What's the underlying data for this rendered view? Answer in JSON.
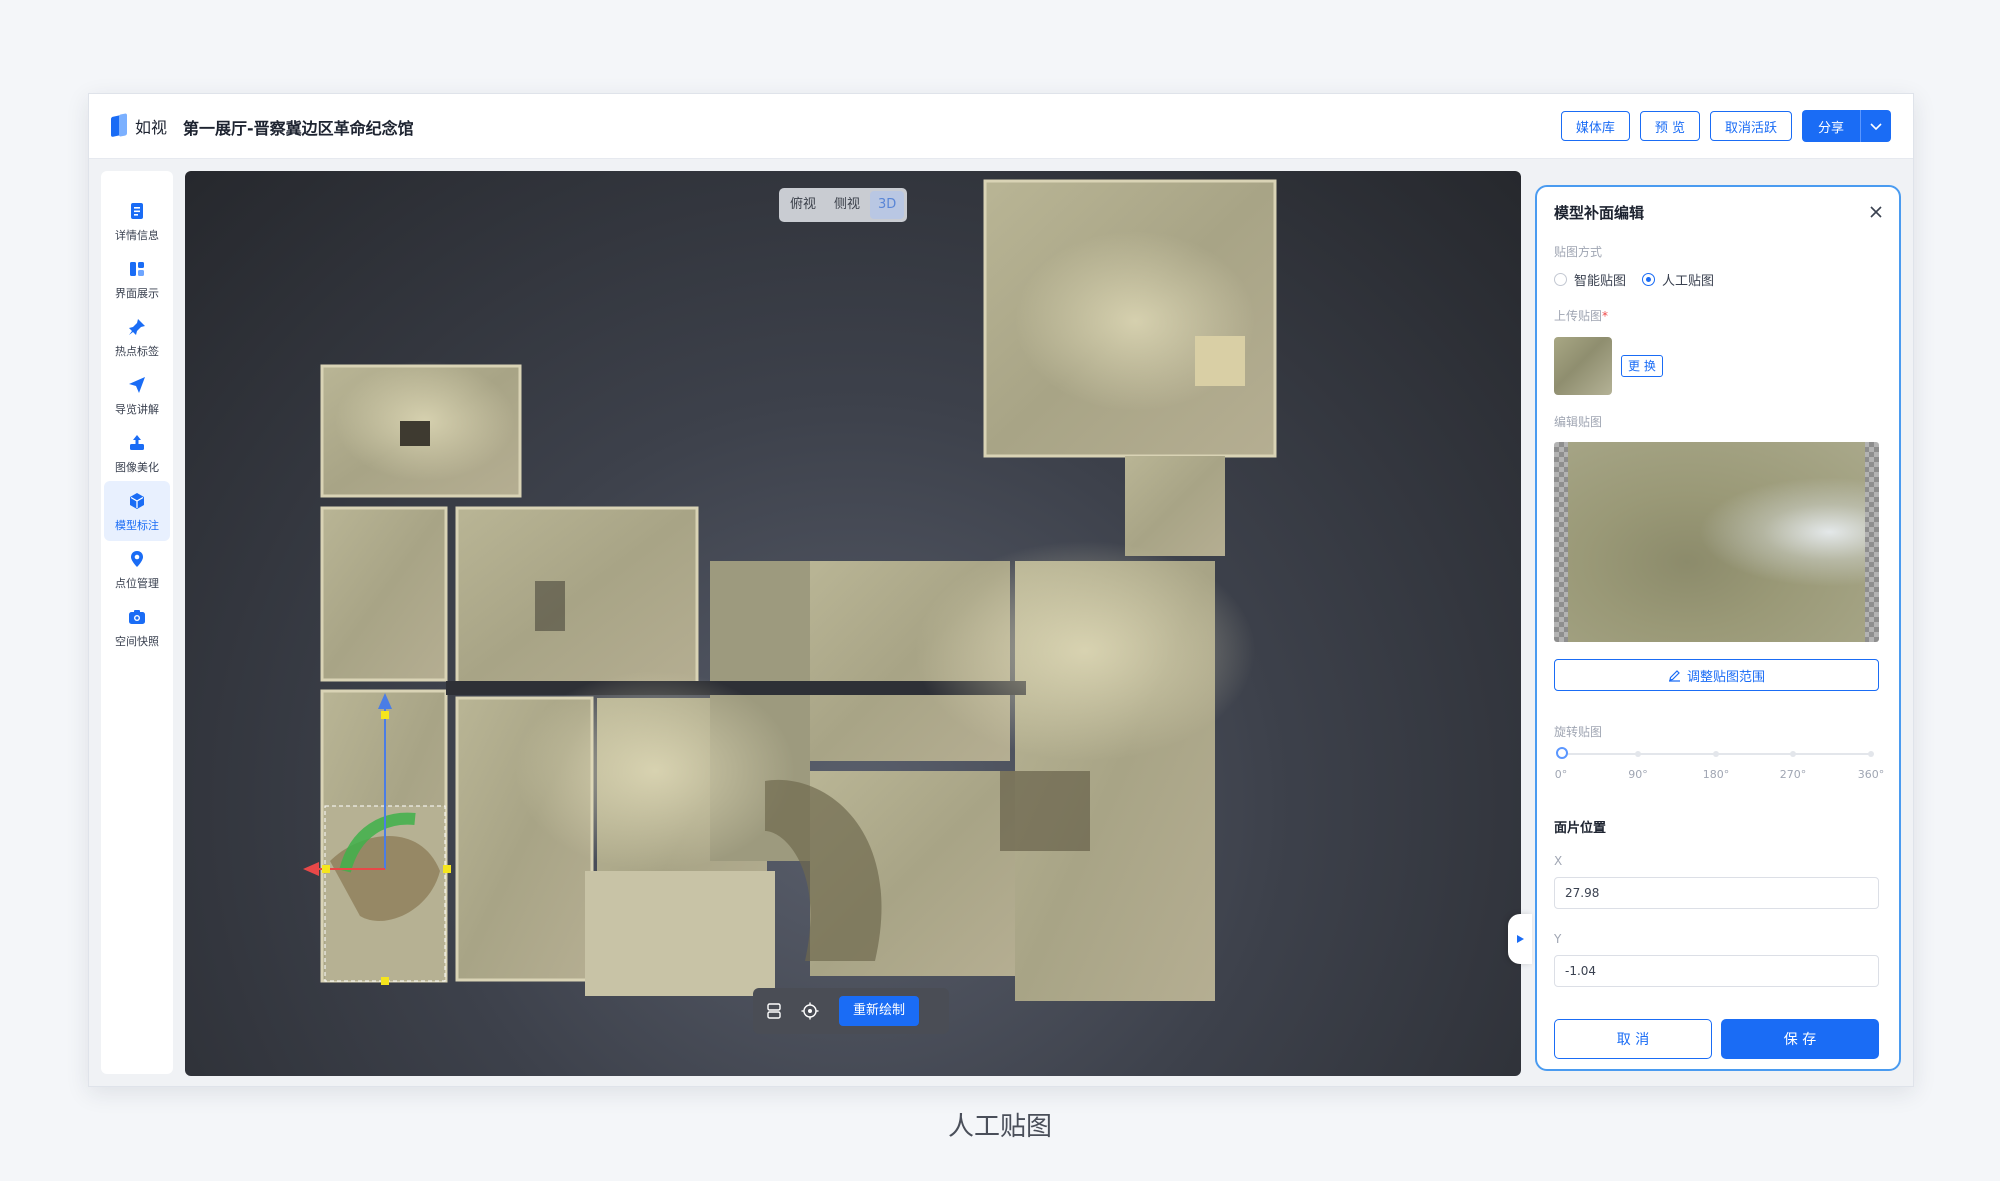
{
  "app": {
    "logo_text": "如视",
    "title": "第一展厅-晋察冀边区革命纪念馆"
  },
  "toolbar": {
    "media_library": "媒体库",
    "preview": "预 览",
    "deactivate": "取消活跃",
    "share": "分享"
  },
  "sidebar": {
    "items": [
      {
        "label": "详情信息",
        "icon": "document-icon"
      },
      {
        "label": "界面展示",
        "icon": "layout-icon"
      },
      {
        "label": "热点标签",
        "icon": "pin-icon"
      },
      {
        "label": "导览讲解",
        "icon": "paper-plane-icon"
      },
      {
        "label": "图像美化",
        "icon": "upload-icon"
      },
      {
        "label": "模型标注",
        "icon": "cube-icon",
        "active": true
      },
      {
        "label": "点位管理",
        "icon": "location-icon"
      },
      {
        "label": "空间快照",
        "icon": "camera-icon"
      }
    ]
  },
  "viewport": {
    "view_modes": [
      "俯视",
      "侧视",
      "3D"
    ],
    "active_view": "3D",
    "redraw_label": "重新绘制"
  },
  "panel": {
    "title": "模型补面编辑",
    "mapping_method_label": "贴图方式",
    "option_smart": "智能贴图",
    "option_manual": "人工贴图",
    "selected_option": "人工贴图",
    "upload_label": "上传贴图",
    "required_mark": "*",
    "change_label": "更 换",
    "edit_label": "编辑贴图",
    "adjust_label": "调整贴图范围",
    "rotate_label": "旋转贴图",
    "rotation_ticks": [
      "0°",
      "90°",
      "180°",
      "270°",
      "360°"
    ],
    "rotation_value": 0,
    "position_title": "面片位置",
    "x_label": "X",
    "x_value": "27.98",
    "y_label": "Y",
    "y_value": "-1.04",
    "cancel_label": "取 消",
    "save_label": "保 存"
  },
  "caption": "人工贴图",
  "colors": {
    "accent": "#1a6cf5",
    "panel_border": "#4a9bf0"
  }
}
